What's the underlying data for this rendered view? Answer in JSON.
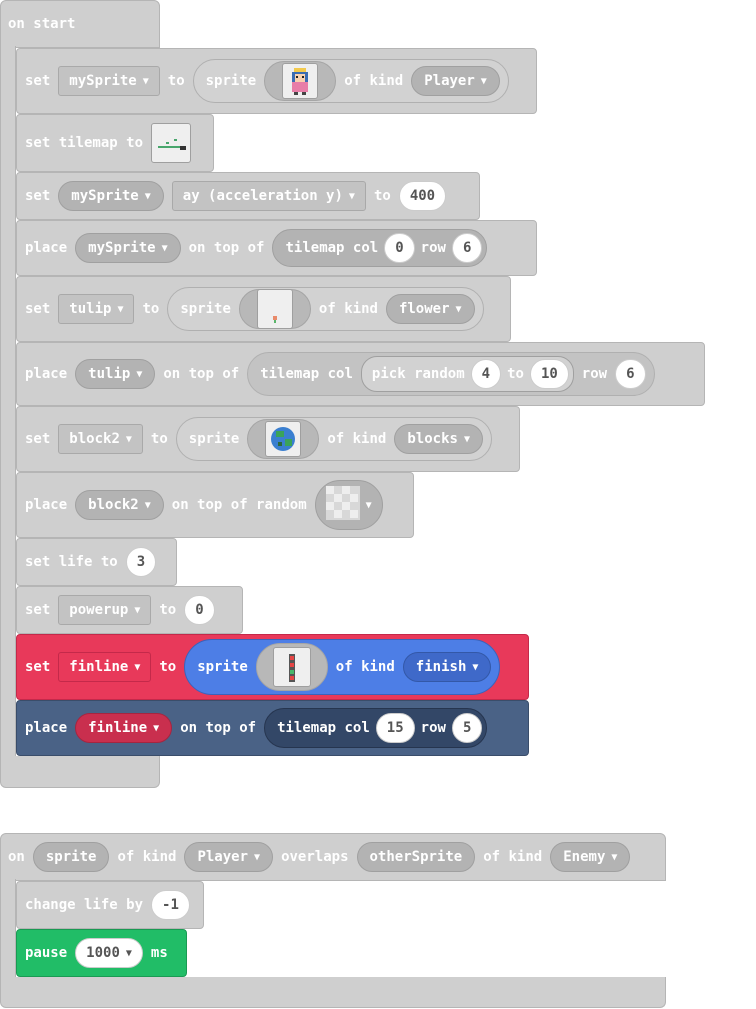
{
  "on_start": {
    "hat": "on start",
    "b1": {
      "set": "set",
      "var": "mySprite",
      "to": "to",
      "sprite": "sprite",
      "ofkind": "of kind",
      "kind": "Player"
    },
    "b2": {
      "label": "set tilemap to"
    },
    "b3": {
      "set": "set",
      "var": "mySprite",
      "prop": "ay (acceleration y)",
      "to": "to",
      "value": "400"
    },
    "b4": {
      "place": "place",
      "var": "mySprite",
      "ontopof": "on top of",
      "tilemap_col": "tilemap col",
      "col": "0",
      "row_label": "row",
      "row": "6"
    },
    "b5": {
      "set": "set",
      "var": "tulip",
      "to": "to",
      "sprite": "sprite",
      "ofkind": "of kind",
      "kind": "flower"
    },
    "b6": {
      "place": "place",
      "var": "tulip",
      "ontopof": "on top of",
      "tilemap_col": "tilemap col",
      "pick_random": "pick random",
      "from": "4",
      "to": "to",
      "upto": "10",
      "row_label": "row",
      "row": "6"
    },
    "b7": {
      "set": "set",
      "var": "block2",
      "to": "to",
      "sprite": "sprite",
      "ofkind": "of kind",
      "kind": "blocks"
    },
    "b8": {
      "place": "place",
      "var": "block2",
      "ontopofrandom": "on top of random"
    },
    "b9": {
      "label": "set life to",
      "value": "3"
    },
    "b10": {
      "set": "set",
      "var": "powerup",
      "to": "to",
      "value": "0"
    },
    "b11": {
      "set": "set",
      "var": "finline",
      "to": "to",
      "sprite": "sprite",
      "ofkind": "of kind",
      "kind": "finish"
    },
    "b12": {
      "place": "place",
      "var": "finline",
      "ontopof": "on top of",
      "tilemap_col": "tilemap col",
      "col": "15",
      "row_label": "row",
      "row": "5"
    }
  },
  "overlap": {
    "on": "on",
    "sprite": "sprite",
    "ofkind1": "of kind",
    "kind1": "Player",
    "overlaps": "overlaps",
    "other": "otherSprite",
    "ofkind2": "of kind",
    "kind2": "Enemy",
    "change": {
      "label": "change life by",
      "value": "-1"
    },
    "pause": {
      "label": "pause",
      "value": "1000",
      "unit": "ms"
    }
  },
  "colors": {
    "grey_block": "#cfcfcf",
    "red_block": "#e8395a",
    "blue_sprite": "#4d7ee6",
    "navy_block": "#4a6286",
    "green_block": "#21bd67"
  },
  "icons": [
    "princess-sprite-icon",
    "tilemap-thumbnail-icon",
    "tulip-image-icon",
    "earth-globe-icon",
    "checker-tile-icon",
    "traffic-light-icon",
    "dropdown-arrow-icon"
  ]
}
